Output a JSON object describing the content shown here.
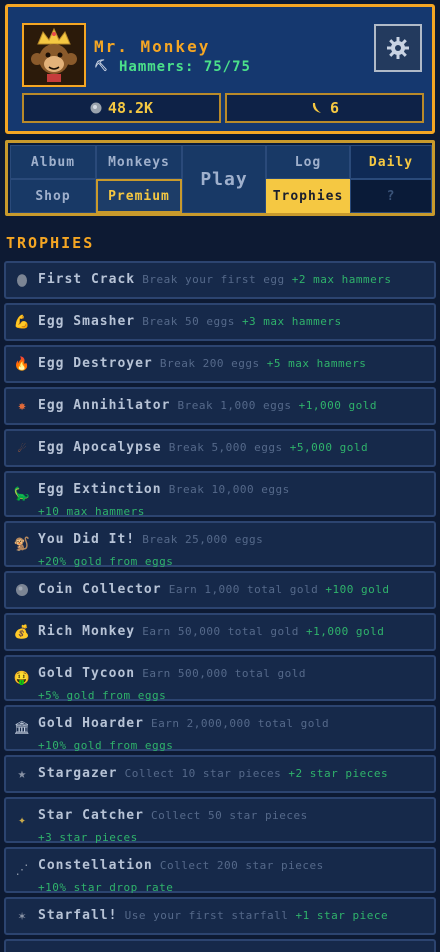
{
  "player": {
    "name": "Mr. Monkey",
    "hammers_label": "Hammers: 75/75",
    "gold": "48.2K",
    "bananas": "6"
  },
  "menu": {
    "album": "Album",
    "monkeys": "Monkeys",
    "play": "Play",
    "log": "Log",
    "daily": "Daily",
    "shop": "Shop",
    "premium": "Premium",
    "trophies": "Trophies",
    "unknown": "?"
  },
  "section_title": "TROPHIES",
  "trophies": [
    {
      "name": "First Crack",
      "desc": "Break your first egg",
      "reward": "+2 max hammers",
      "icon": "egg-icon"
    },
    {
      "name": "Egg Smasher",
      "desc": "Break 50 eggs",
      "reward": "+3 max hammers",
      "icon": "flexed-arm-icon"
    },
    {
      "name": "Egg Destroyer",
      "desc": "Break 200 eggs",
      "reward": "+5 max hammers",
      "icon": "fire-icon"
    },
    {
      "name": "Egg Annihilator",
      "desc": "Break 1,000 eggs",
      "reward": "+1,000 gold",
      "icon": "explosion-icon"
    },
    {
      "name": "Egg Apocalypse",
      "desc": "Break 5,000 eggs",
      "reward": "+5,000 gold",
      "icon": "meteor-icon"
    },
    {
      "name": "Egg Extinction",
      "desc": "Break 10,000 eggs",
      "reward": "+10 max hammers",
      "icon": "dinosaur-icon"
    },
    {
      "name": "You Did It!",
      "desc": "Break 25,000 eggs",
      "reward": "+20% gold from eggs",
      "icon": "monkey-icon"
    },
    {
      "name": "Coin Collector",
      "desc": "Earn 1,000 total gold",
      "reward": "+100 gold",
      "icon": "coin-icon"
    },
    {
      "name": "Rich Monkey",
      "desc": "Earn 50,000 total gold",
      "reward": "+1,000 gold",
      "icon": "money-bag-icon"
    },
    {
      "name": "Gold Tycoon",
      "desc": "Earn 500,000 total gold",
      "reward": "+5% gold from eggs",
      "icon": "money-face-icon"
    },
    {
      "name": "Gold Hoarder",
      "desc": "Earn 2,000,000 total gold",
      "reward": "+10% gold from eggs",
      "icon": "bank-icon"
    },
    {
      "name": "Stargazer",
      "desc": "Collect 10 star pieces",
      "reward": "+2 star pieces",
      "icon": "star-icon"
    },
    {
      "name": "Star Catcher",
      "desc": "Collect 50 star pieces",
      "reward": "+3 star pieces",
      "icon": "sparkle-icon"
    },
    {
      "name": "Constellation",
      "desc": "Collect 200 star pieces",
      "reward": "+10% star drop rate",
      "icon": "constellation-icon"
    },
    {
      "name": "Starfall!",
      "desc": "Use your first starfall",
      "reward": "+1 star piece",
      "icon": "shooting-star-icon"
    }
  ]
}
